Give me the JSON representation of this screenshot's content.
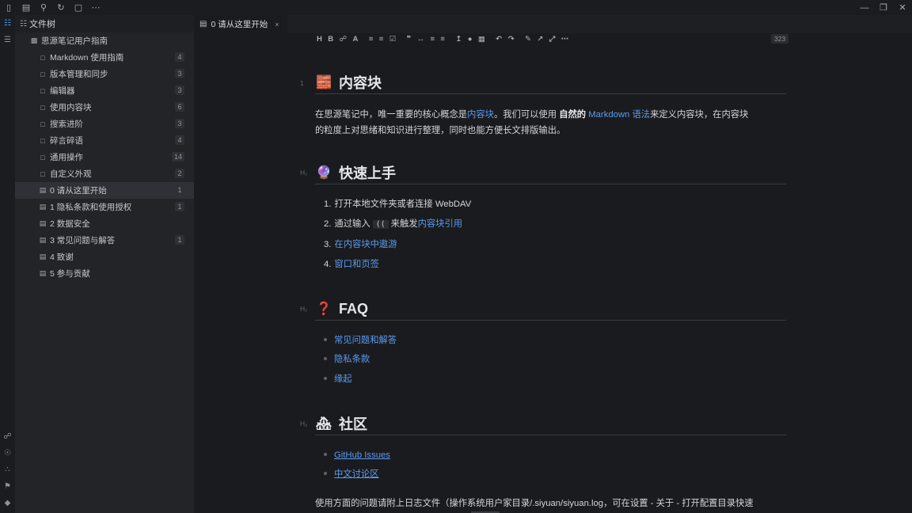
{
  "topbar": {
    "left_icons": [
      "notebook-icon",
      "calendar-icon",
      "search-icon",
      "sync-icon",
      "window-icon",
      "more-icon"
    ],
    "right_icons": [
      "minimize-icon",
      "maximize-icon",
      "close-icon"
    ]
  },
  "filetree": {
    "title": "文件树",
    "notebook": "思源笔记用户指南",
    "items": [
      {
        "label": "Markdown 使用指南",
        "count": "4",
        "type": "folder"
      },
      {
        "label": "版本管理和同步",
        "count": "3",
        "type": "folder"
      },
      {
        "label": "编辑器",
        "count": "3",
        "type": "folder"
      },
      {
        "label": "使用内容块",
        "count": "6",
        "type": "folder"
      },
      {
        "label": "搜索进阶",
        "count": "3",
        "type": "folder"
      },
      {
        "label": "碎言碎语",
        "count": "4",
        "type": "folder"
      },
      {
        "label": "通用操作",
        "count": "14",
        "type": "folder"
      },
      {
        "label": "自定义外观",
        "count": "2",
        "type": "folder"
      },
      {
        "label": "0 请从这里开始",
        "count": "1",
        "type": "doc"
      },
      {
        "label": "1 隐私条款和使用授权",
        "count": "1",
        "type": "doc"
      },
      {
        "label": "2 数据安全",
        "count": "",
        "type": "doc"
      },
      {
        "label": "3 常见问题与解答",
        "count": "1",
        "type": "doc"
      },
      {
        "label": "4 致谢",
        "count": "",
        "type": "doc"
      },
      {
        "label": "5 参与贡献",
        "count": "",
        "type": "doc"
      }
    ]
  },
  "tab": {
    "label": "0 请从这里开始",
    "close": "×"
  },
  "toolbar": {
    "word_count": "323"
  },
  "doc": {
    "block_marker": "1",
    "h2_marker": "H₂",
    "section1": {
      "title": "内容块",
      "p1_a": "在思源笔记中，唯一重要的核心概念是",
      "p1_link": "内容块",
      "p1_b": "。我们可以使用 ",
      "p1_bold": "自然的",
      "p1_link2": " Markdown 语法",
      "p1_c": "来定义内容块，在内容块",
      "p2": "的粒度上对思绪和知识进行整理，同时也能方便长文排版输出。"
    },
    "section2": {
      "title": "快速上手",
      "li1": "打开本地文件夹或者连接 WebDAV",
      "li2_a": "通过输入",
      "li2_code": "((",
      "li2_b": "来触发",
      "li2_link": "内容块引用",
      "li3": "在内容块中遨游",
      "li4": "窗口和页签",
      "nums": [
        "1.",
        "2.",
        "3.",
        "4."
      ]
    },
    "section3": {
      "title": "FAQ",
      "items": [
        "常见问题和解答",
        "隐私条款",
        "缘起"
      ]
    },
    "section4": {
      "title": "社区",
      "items": [
        "GitHub Issues",
        "中文讨论区"
      ],
      "tail": "使用方面的问题请附上日志文件（操作系统用户家目录/.siyuan/siyuan.log，可在设置 - 关于 - 打开配置目录快速"
    }
  }
}
